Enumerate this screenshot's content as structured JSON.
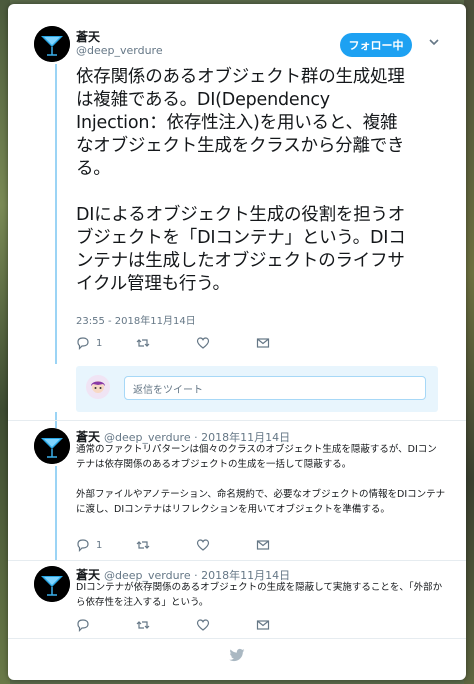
{
  "author": {
    "name": "蒼天",
    "handle": "@deep_verdure"
  },
  "main_tweet": {
    "follow_label": "フォロー中",
    "text": "依存関係のあるオブジェクト群の生成処理は複雑である。DI(Dependency Injection：依存性注入)を用いると、複雑なオブジェクト生成をクラスから分離できる。\n\nDIによるオブジェクト生成の役割を担うオブジェクトを「DIコンテナ」という。DIコンテナは生成したオブジェクトのライフサイクル管理も行う。",
    "timestamp": "23:55 - 2018年11月14日",
    "reply_count": "1"
  },
  "reply_box": {
    "placeholder": "返信をツイート"
  },
  "replies": [
    {
      "name": "蒼天",
      "meta": "@deep_verdure · 2018年11月14日",
      "text": "通常のファクトリパターンは個々のクラスのオブジェクト生成を隠蔽するが、DIコンテナは依存関係のあるオブジェクトの生成を一括して隠蔽する。\n\n外部ファイルやアノテーション、命名規約で、必要なオブジェクトの情報をDIコンテナに渡し、DIコンテナはリフレクションを用いてオブジェクトを準備する。",
      "reply_count": "1"
    },
    {
      "name": "蒼天",
      "meta": "@deep_verdure · 2018年11月14日",
      "text": "DIコンテナが依存関係のあるオブジェクトの生成を隠蔽して実施することを、「外部から依存性を注入する」という。",
      "reply_count": ""
    }
  ],
  "colors": {
    "accent": "#1da1f2",
    "thread_line": "#9bd4f5",
    "muted": "#657786"
  }
}
